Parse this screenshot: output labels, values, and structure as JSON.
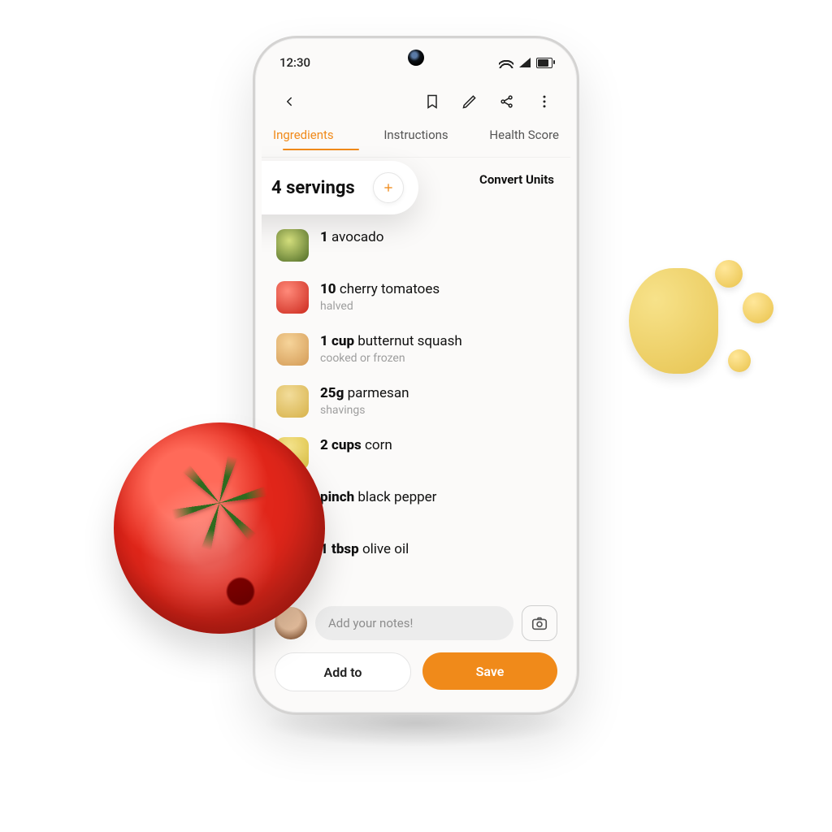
{
  "status": {
    "time": "12:30"
  },
  "tabs": {
    "ingredients": "Ingredients",
    "instructions": "Instructions",
    "health": "Health Score",
    "active": "Ingredients"
  },
  "servings": {
    "label": "4 servings"
  },
  "convert_label": "Convert Units",
  "ingredients": [
    {
      "qty": "1",
      "name": "avocado",
      "sub": ""
    },
    {
      "qty": "10",
      "name": "cherry tomatoes",
      "sub": "halved"
    },
    {
      "qty": "1 cup",
      "name": "butternut squash",
      "sub": "cooked or frozen"
    },
    {
      "qty": "25g",
      "name": "parmesan",
      "sub": "shavings"
    },
    {
      "qty": "2 cups",
      "name": "corn",
      "sub": ""
    },
    {
      "qty": "pinch",
      "name": "black pepper",
      "sub": ""
    },
    {
      "qty": "1 tbsp",
      "name": "olive oil",
      "sub": ""
    }
  ],
  "notes_placeholder": "Add your notes!",
  "buttons": {
    "add": "Add to",
    "save": "Save"
  },
  "colors": {
    "accent": "#f08a1a"
  }
}
